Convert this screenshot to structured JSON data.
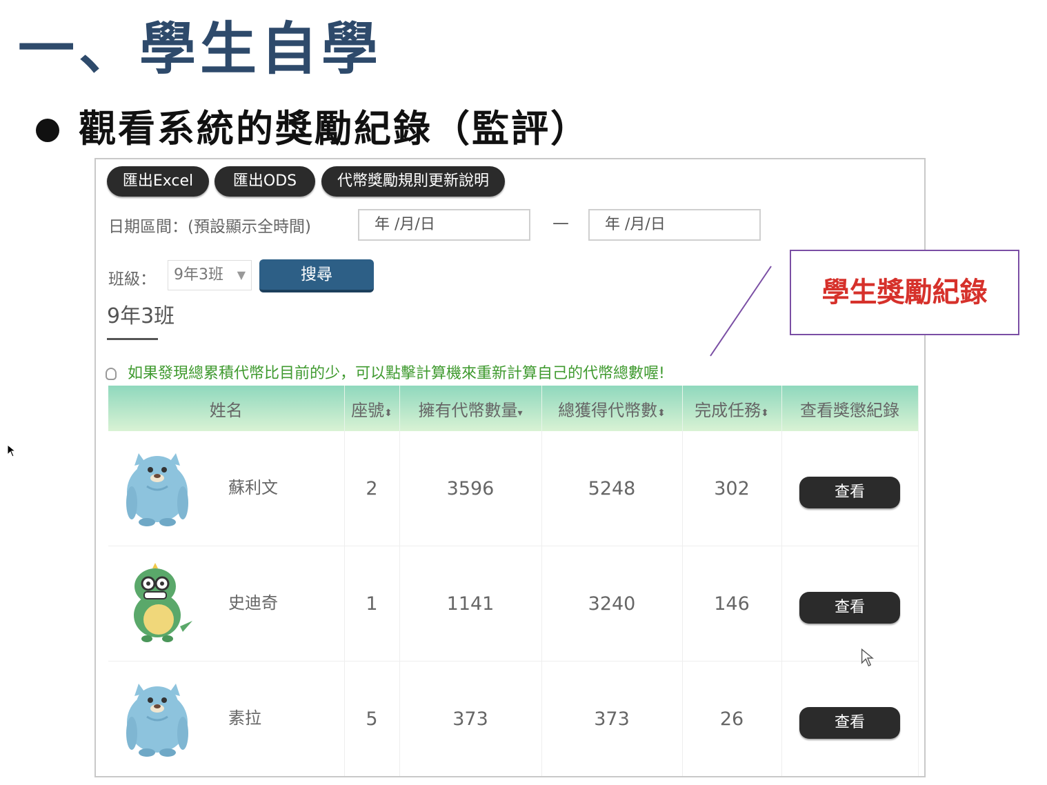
{
  "slide": {
    "title": "一、學生自學",
    "bullet": "觀看系統的獎勵紀錄（監評）"
  },
  "toolbar": {
    "export_excel": "匯出Excel",
    "export_ods": "匯出ODS",
    "rules_update": "代幣獎勵規則更新說明"
  },
  "filters": {
    "date_label": "日期區間：(預設顯示全時間)",
    "start_date_placeholder": "年 /月/日",
    "separator": "—",
    "end_date_placeholder": "年 /月/日",
    "class_label": "班級：",
    "class_value": "9年3班",
    "search_label": "搜尋"
  },
  "class_heading": "9年3班",
  "notice_text": "如果發現總累積代幣比目前的少，可以點擊計算機來重新計算自己的代幣總數喔!",
  "table": {
    "headers": {
      "name": "姓名",
      "seat": "座號",
      "owned": "擁有代幣數量",
      "total": "總獲得代幣數",
      "tasks": "完成任務",
      "view": "查看獎懲紀錄"
    },
    "sort_icons": {
      "seat": "sort-icon",
      "owned": "sort-desc-icon",
      "total": "sort-icon",
      "tasks": "sort-icon"
    },
    "rows": [
      {
        "avatar": "blue-monster-icon",
        "name": "蘇利文",
        "seat": "2",
        "owned": "3596",
        "total": "5248",
        "tasks": "302",
        "action": "查看"
      },
      {
        "avatar": "green-dinosaur-icon",
        "name": "史迪奇",
        "seat": "1",
        "owned": "1141",
        "total": "3240",
        "tasks": "146",
        "action": "查看"
      },
      {
        "avatar": "blue-monster-icon",
        "name": "素拉",
        "seat": "5",
        "owned": "373",
        "total": "373",
        "tasks": "26",
        "action": "查看"
      }
    ]
  },
  "callout": {
    "text": "學生獎勵紀錄",
    "border_color": "#7a4ea4",
    "text_color": "#d6312b"
  },
  "colors": {
    "title": "#2e4a6b",
    "header_gradient_top": "#8fd8bd",
    "header_gradient_bottom": "#d9f2d4",
    "notice": "#3f9a2f",
    "search_button": "#2d5f86"
  }
}
